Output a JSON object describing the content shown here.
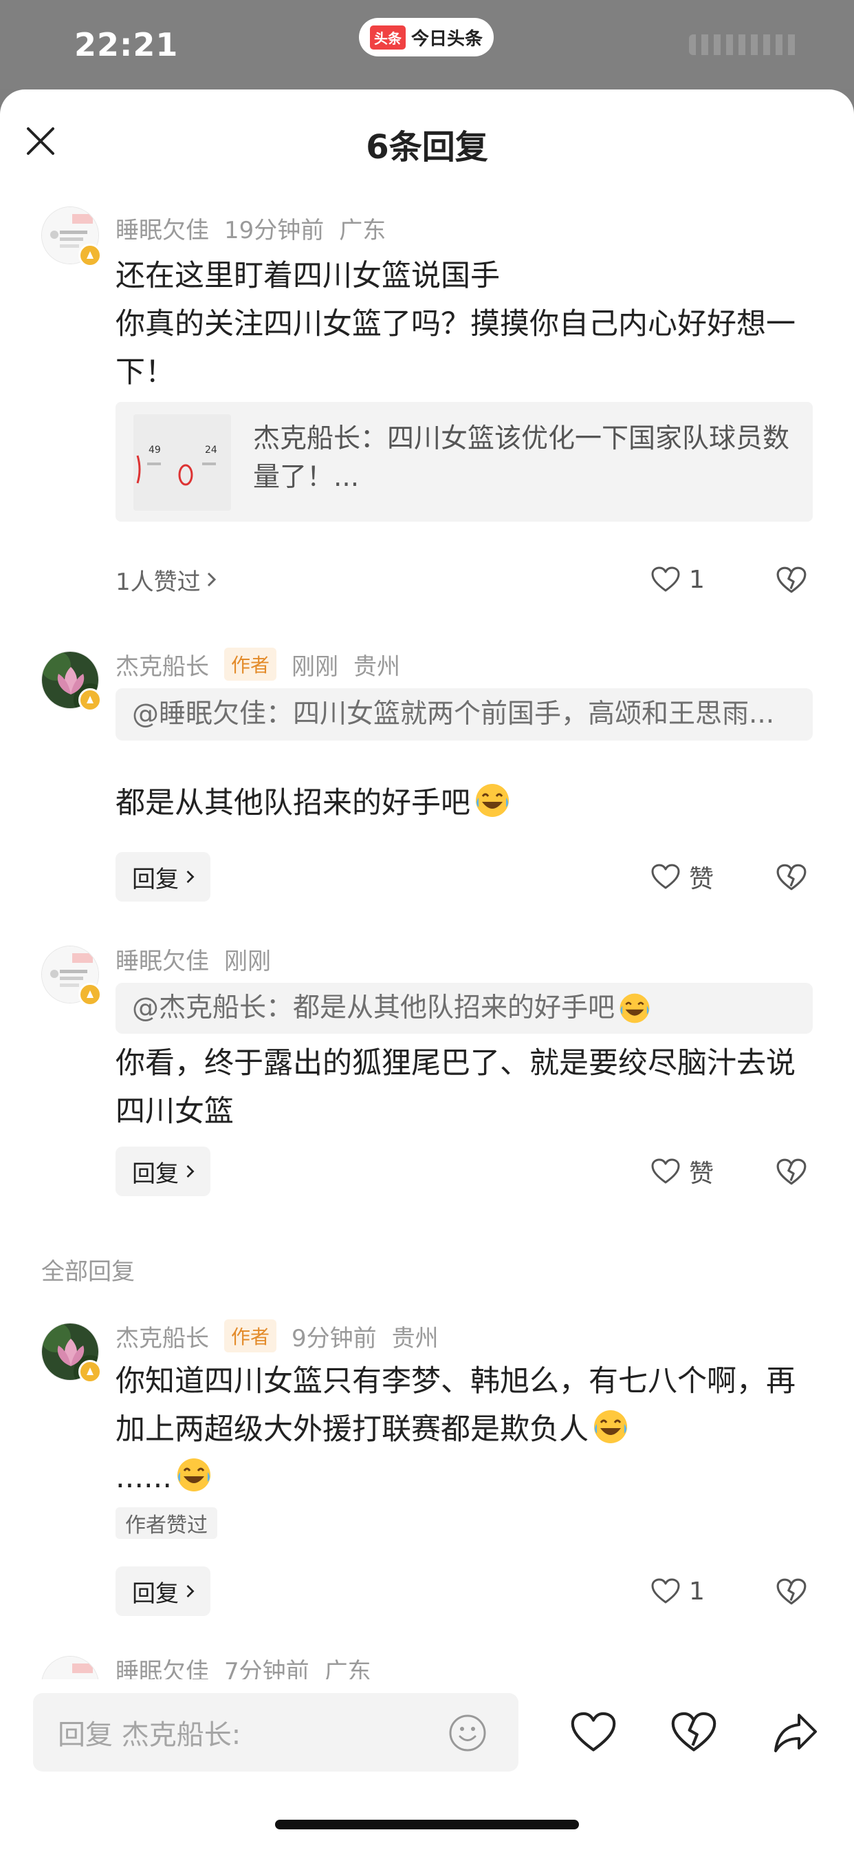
{
  "status_bar": {
    "time": "22:21",
    "app_logo": "头条",
    "app_name": "今日头条"
  },
  "header": {
    "title": "6条回复",
    "close_icon": "close-icon"
  },
  "comments": [
    {
      "user": "睡眠欠佳",
      "time": "19分钟前",
      "location": "广东",
      "text": "还在这里盯着四川女篮说国手\n你真的关注四川女篮了吗？摸摸你自己内心好好想一下！",
      "link_card_text": "杰克船长：四川女篮该优化一下国家队球员数量了！...",
      "likers_text": "1人赞过",
      "like_count": "1"
    },
    {
      "user": "杰克船长",
      "author_tag": "作者",
      "time": "刚刚",
      "location": "贵州",
      "quote": "@睡眠欠佳：四川女篮就两个前国手，高颂和王思雨...",
      "text": "都是从其他队招来的好手吧",
      "reply_label": "回复",
      "like_label": "赞"
    },
    {
      "user": "睡眠欠佳",
      "time": "刚刚",
      "quote": "@杰克船长：都是从其他队招来的好手吧",
      "text": "你看，终于露出的狐狸尾巴了、就是要绞尽脑汁去说四川女篮",
      "reply_label": "回复",
      "like_label": "赞"
    },
    {
      "user": "杰克船长",
      "author_tag": "作者",
      "time": "9分钟前",
      "location": "贵州",
      "text": "你知道四川女篮只有李梦、韩旭么，有七八个啊，再加上两超级大外援打联赛都是欺负人",
      "text_tail": "......",
      "author_liked": "作者赞过",
      "reply_label": "回复",
      "like_count": "1"
    },
    {
      "user": "睡眠欠佳",
      "time": "7分钟前",
      "location": "广东"
    }
  ],
  "section_label": "全部回复",
  "bottom_bar": {
    "input_placeholder": "回复 杰克船长:"
  },
  "colors": {
    "author_tag": "#e38b2a",
    "meta_gray": "#9a9a9a",
    "quote_bg": "#f3f3f3",
    "brand_red": "#f04142"
  }
}
